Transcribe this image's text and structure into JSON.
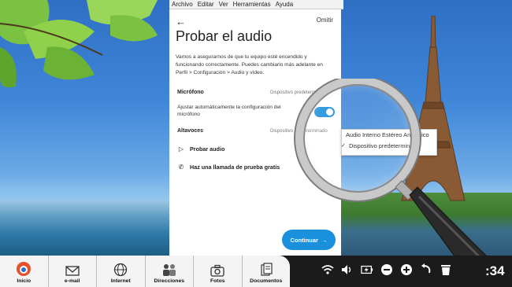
{
  "menubar": {
    "items": [
      "Archivo",
      "Editar",
      "Ver",
      "Herramientas",
      "Ayuda"
    ]
  },
  "dialog": {
    "skip": "Omitir",
    "title": "Probar el audio",
    "description": "Vamos a asegurarnos de que tu equipo esté encendido y funcionando correctamente. Puedes cambiarlo más adelante en Perfil > Configuración > Audio y vídeo.",
    "microphone_label": "Micrófono",
    "microphone_value": "Dispositivo predeterminado",
    "auto_adjust": "Ajustar automáticamente la configuración del micrófono",
    "auto_adjust_on": true,
    "speakers_label": "Altavoces",
    "speakers_value": "Dispositivo predeterminado",
    "test_audio": "Probar audio",
    "test_call": "Haz una llamada de prueba gratis",
    "continue": "Continuar",
    "accent_color": "#1a8fdc"
  },
  "dropdown": {
    "options": [
      "Audio Interno Estéreo Analógico",
      "Dispositivo predeterminado"
    ],
    "selected_index": 1
  },
  "taskbar": {
    "items": [
      {
        "label": "Inicio",
        "icon": "home-logo-icon"
      },
      {
        "label": "e-mail",
        "icon": "envelope-icon"
      },
      {
        "label": "Internet",
        "icon": "globe-icon"
      },
      {
        "label": "Direcciones",
        "icon": "contacts-icon"
      },
      {
        "label": "Fotos",
        "icon": "camera-icon"
      },
      {
        "label": "Documentos",
        "icon": "documents-icon"
      }
    ],
    "clock": ":34"
  }
}
